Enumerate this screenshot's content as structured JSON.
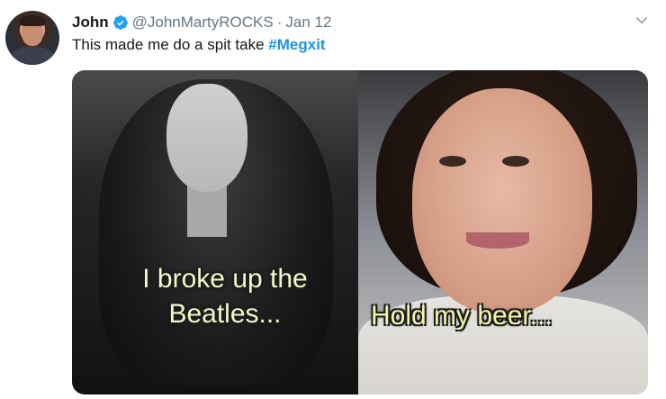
{
  "author": {
    "name": "John",
    "handle": "@JohnMartyROCKS",
    "separator": "·",
    "date": "Jan 12"
  },
  "tweet": {
    "text": "This made me do a spit take ",
    "hashtag": "#Megxit"
  },
  "media": {
    "left_caption_line1": "I broke up the",
    "left_caption_line2": "Beatles...",
    "right_caption": "Hold my beer..."
  },
  "icons": {
    "verified": "verified-badge-icon",
    "menu": "chevron-down-icon"
  },
  "colors": {
    "hashtag": "#1b95e0",
    "verified": "#1da1f2",
    "secondary_text": "#657786",
    "caption_text": "#f3f8c8"
  }
}
